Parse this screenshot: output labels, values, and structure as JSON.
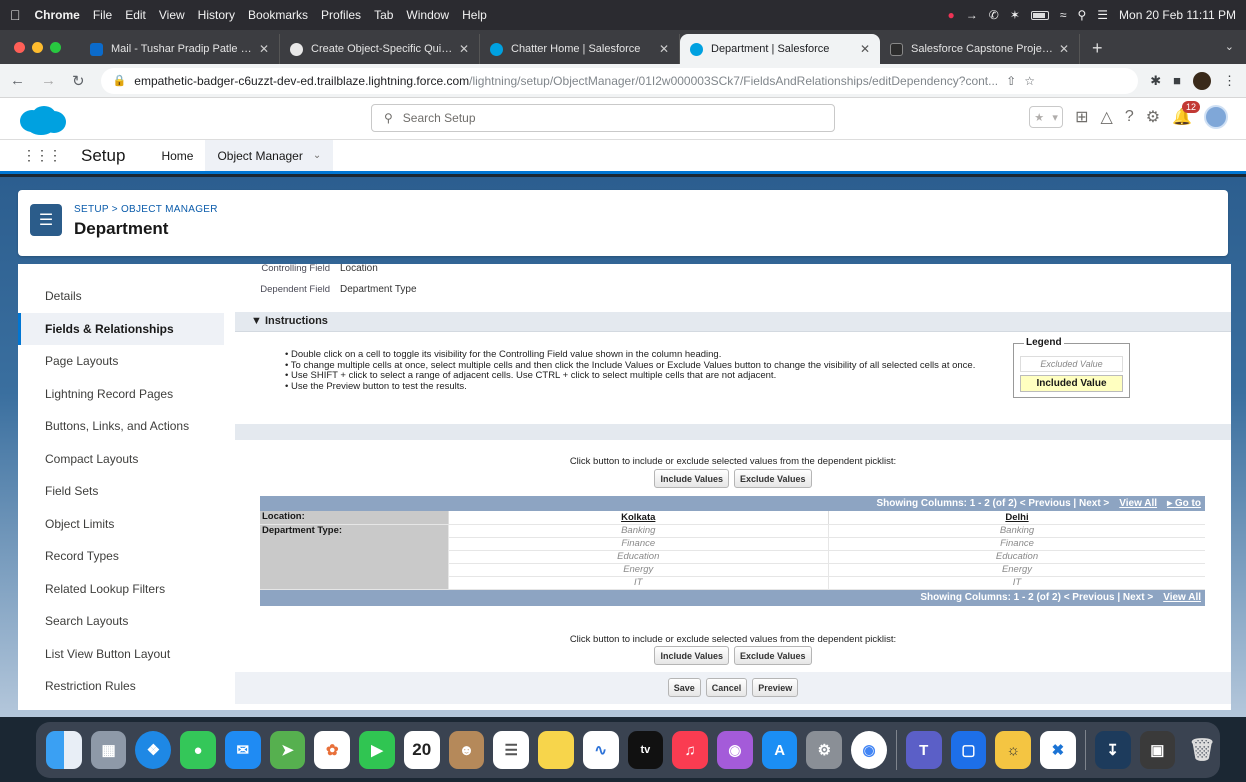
{
  "menubar": {
    "app": "Chrome",
    "items": [
      "File",
      "Edit",
      "View",
      "History",
      "Bookmarks",
      "Profiles",
      "Tab",
      "Window",
      "Help"
    ],
    "clock": "Mon 20 Feb  11:11 PM"
  },
  "tabs": [
    {
      "label": "Mail - Tushar Pradip Patle - Ou",
      "color": "#0b6bcb"
    },
    {
      "label": "Create Object-Specific Quick A",
      "color": "#1d1d1d"
    },
    {
      "label": "Chatter Home | Salesforce",
      "color": "#00a1e0"
    },
    {
      "label": "Department | Salesforce",
      "color": "#00a1e0"
    },
    {
      "label": "Salesforce Capstone Project -",
      "color": "#2c2c2c"
    }
  ],
  "address": {
    "host": "empathetic-badger-c6uzzt-dev-ed.trailblaze.lightning.force.com",
    "path": "/lightning/setup/ObjectManager/01I2w000003SCk7/FieldsAndRelationships/editDependency?cont..."
  },
  "header": {
    "search_placeholder": "Search Setup",
    "notification_count": "12"
  },
  "appnav": {
    "app_name": "Setup",
    "home": "Home",
    "object_manager": "Object Manager"
  },
  "object": {
    "breadcrumb": "SETUP > OBJECT MANAGER",
    "title": "Department"
  },
  "sidebar": {
    "items": [
      "Details",
      "Fields & Relationships",
      "Page Layouts",
      "Lightning Record Pages",
      "Buttons, Links, and Actions",
      "Compact Layouts",
      "Field Sets",
      "Object Limits",
      "Record Types",
      "Related Lookup Filters",
      "Search Layouts",
      "List View Button Layout",
      "Restriction Rules"
    ]
  },
  "dependency": {
    "controlling_label": "Controlling Field",
    "controlling_value": "Location",
    "dependent_label": "Dependent Field",
    "dependent_value": "Department Type",
    "instructions_title": "Instructions",
    "instructions": [
      "Double click on a cell to toggle its visibility for the Controlling Field value shown in the column heading.",
      "To change multiple cells at once, select multiple cells and then click the Include Values or Exclude Values button to change the visibility of all selected cells at once.",
      "Use SHIFT + click to select a range of adjacent cells. Use CTRL + click to select multiple cells that are not adjacent.",
      "Use the Preview button to test the results."
    ],
    "legend_title": "Legend",
    "legend_excluded": "Excluded Value",
    "legend_included": "Included Value",
    "hint": "Click button to include or exclude selected values from the dependent picklist:",
    "include_btn": "Include Values",
    "exclude_btn": "Exclude Values",
    "showing_top": "Showing Columns: 1 - 2 (of 2) < Previous | Next >",
    "view_all": "View All",
    "goto": "Go to",
    "showing_bottom": "Showing Columns: 1 - 2 (of 2) < Previous | Next >",
    "row_location": "Location:",
    "row_dept": "Department Type:",
    "columns": [
      "Kolkata",
      "Delhi"
    ],
    "values": [
      "Banking",
      "Finance",
      "Education",
      "Energy",
      "IT"
    ],
    "save": "Save",
    "cancel": "Cancel",
    "preview": "Preview"
  }
}
